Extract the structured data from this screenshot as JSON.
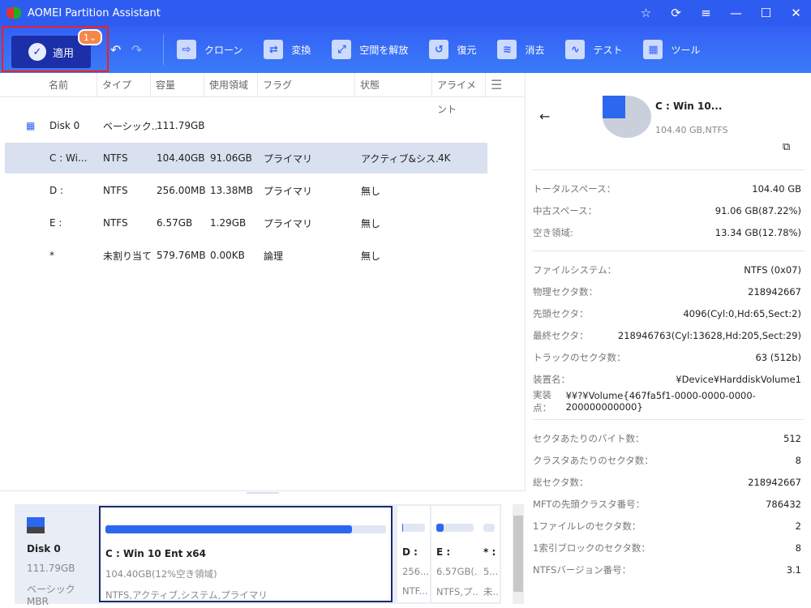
{
  "app": {
    "title": "AOMEI Partition Assistant"
  },
  "titlebar": {
    "icons": [
      "star-icon",
      "refresh-icon",
      "menu-icon",
      "minimize-icon",
      "maximize-icon",
      "close-icon"
    ]
  },
  "toolbar": {
    "apply": "適用",
    "badge": "1",
    "tools": [
      {
        "label": "クローン",
        "icon": "clone-icon"
      },
      {
        "label": "変換",
        "icon": "convert-icon"
      },
      {
        "label": "空間を解放",
        "icon": "free-space-icon"
      },
      {
        "label": "復元",
        "icon": "recover-icon"
      },
      {
        "label": "消去",
        "icon": "wipe-icon"
      },
      {
        "label": "テスト",
        "icon": "test-icon"
      },
      {
        "label": "ツール",
        "icon": "tools-icon"
      }
    ]
  },
  "columns": [
    "名前",
    "タイプ",
    "容量",
    "使用領域",
    "フラグ",
    "状態",
    "アライメント"
  ],
  "rows": [
    {
      "name": "Disk 0",
      "type": "ベーシック...",
      "cap": "111.79GB",
      "used": "",
      "flag": "",
      "status": "",
      "align": ""
    },
    {
      "name": "C : Wi...",
      "type": "NTFS",
      "cap": "104.40GB",
      "used": "91.06GB",
      "flag": "プライマリ",
      "status": "アクティブ&シス...",
      "align": "4K"
    },
    {
      "name": "D :",
      "type": "NTFS",
      "cap": "256.00MB",
      "used": "13.38MB",
      "flag": "プライマリ",
      "status": "無し",
      "align": ""
    },
    {
      "name": "E :",
      "type": "NTFS",
      "cap": "6.57GB",
      "used": "1.29GB",
      "flag": "プライマリ",
      "status": "無し",
      "align": ""
    },
    {
      "name": "*",
      "type": "未割り当て",
      "cap": "579.76MB",
      "used": "0.00KB",
      "flag": "論理",
      "status": "無し",
      "align": ""
    }
  ],
  "diskmap": {
    "disk": {
      "name": "Disk 0",
      "size": "111.79GB",
      "type": "ベーシック MBR"
    },
    "parts": [
      {
        "title": "C : Win 10 Ent x64",
        "sub": "104.40GB(12%空き領域)",
        "fs": "NTFS,アクティブ,システム,プライマリ",
        "used_pct": 88
      },
      {
        "title": "D :",
        "sub": "256...",
        "fs": "NTF...",
        "used_pct": 5
      },
      {
        "title": "E :",
        "sub": "6.57GB(...",
        "fs": "NTFS,プ...",
        "used_pct": 20
      },
      {
        "title": "* :",
        "sub": "5...",
        "fs": "未...",
        "used_pct": 0
      }
    ]
  },
  "details": {
    "title": "C : Win 10...",
    "sub": "104.40 GB,NTFS",
    "g1": [
      [
        "トータルスペース：",
        "104.40 GB"
      ],
      [
        "中古スペース：",
        "91.06 GB(87.22%)"
      ],
      [
        "空き領域:",
        "13.34 GB(12.78%)"
      ]
    ],
    "g2": [
      [
        "ファイルシステム：",
        "NTFS (0x07)"
      ],
      [
        "物理セクタ数：",
        "218942667"
      ],
      [
        "先頭セクタ：",
        "4096(Cyl:0,Hd:65,Sect:2)"
      ],
      [
        "最終セクタ：",
        "218946763(Cyl:13628,Hd:205,Sect:29)"
      ],
      [
        "トラックのセクタ数：",
        "63 (512b)"
      ],
      [
        "装置名：",
        "¥Device¥HarddiskVolume1"
      ],
      [
        "実装点：",
        "¥¥?¥Volume{467fa5f1-0000-0000-0000-200000000000}"
      ]
    ],
    "g3": [
      [
        "セクタあたりのバイト数：",
        "512"
      ],
      [
        "クラスタあたりのセクタ数：",
        "8"
      ],
      [
        "総セクタ数：",
        "218942667"
      ],
      [
        "MFTの先頭クラスタ番号：",
        "786432"
      ],
      [
        "1ファイルレのセクタ数：",
        "2"
      ],
      [
        "1索引ブロックのセクタ数：",
        "8"
      ],
      [
        "NTFSバージョン番号：",
        "3.1"
      ]
    ]
  }
}
